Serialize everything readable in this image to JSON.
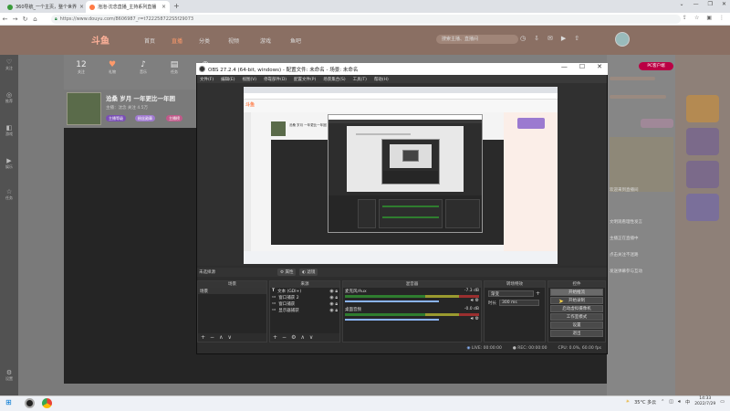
{
  "browser": {
    "tabs": [
      {
        "label": "360导航_一个主页，整个世界",
        "active": false
      },
      {
        "label": "泡泡-沈念直播_主持系列直播",
        "active": true
      }
    ],
    "url": "https://www.douyu.com/8606987_r=t722258722S5f29073",
    "new_tab": "+"
  },
  "site": {
    "logo": "斗鱼",
    "nav": [
      "首页",
      "直播",
      "分类",
      "视频",
      "游戏",
      "鱼吧"
    ],
    "active_nav": "直播",
    "search_placeholder": "搜索主播、直播间",
    "subnav": [
      {
        "n": "12",
        "label": "关注"
      },
      {
        "n": "♥",
        "label": "礼物"
      },
      {
        "n": "♪",
        "label": "音乐"
      },
      {
        "n": "▤",
        "label": "任务"
      },
      {
        "n": "◉",
        "label": "活动"
      }
    ],
    "streamer_title": "沧桑 岁月 一年更比一年困",
    "streamer_sub": "主播：沈念  关注 4.5万",
    "pills": [
      "主播等级",
      "粉丝勋章",
      "主播榜"
    ],
    "sidebar": [
      {
        "icon": "♡",
        "label": "关注"
      },
      {
        "icon": "◎",
        "label": "推荐"
      },
      {
        "icon": "◧",
        "label": "游戏"
      },
      {
        "icon": "▶",
        "label": "娱乐"
      },
      {
        "icon": "☆",
        "label": "任务"
      },
      {
        "icon": "⚙",
        "label": "设置"
      }
    ],
    "pc_download": "PC客户端",
    "right_text": [
      "欢迎来到直播间",
      "文明观看理性发言",
      "主播正在直播中",
      "点击关注不迷路",
      "发送弹幕参与互动"
    ]
  },
  "obs": {
    "title": "OBS 27.2.4 (64-bit, windows) - 配置文件: 未命名 - 场景: 未命名",
    "menu": [
      "文件(F)",
      "编辑(E)",
      "视图(V)",
      "停靠部件(D)",
      "配置文件(P)",
      "场景集合(S)",
      "工具(T)",
      "帮助(H)"
    ],
    "source_bar": "未选择源",
    "source_bar_props": "属性",
    "source_bar_filters": "滤镜",
    "docks": {
      "scenes": {
        "title": "场景",
        "items": [
          "场景"
        ]
      },
      "sources": {
        "title": "来源",
        "items": [
          "文本 (GDI+)",
          "窗口捕获 2",
          "窗口捕获",
          "显示器捕获"
        ]
      },
      "mixer": {
        "title": "混音器",
        "channels": [
          {
            "name": "麦克风/Aux",
            "db": "-7.3 dB"
          },
          {
            "name": "桌面音频",
            "db": "-0.0 dB"
          }
        ]
      },
      "transitions": {
        "title": "转场特效",
        "mode": "渐变",
        "duration_label": "时长",
        "duration": "300 ms"
      },
      "controls": {
        "title": "控件",
        "buttons": [
          "开始推流",
          "开始录制",
          "启动虚拟摄像机",
          "工作室模式",
          "设置",
          "退出"
        ]
      }
    },
    "status": {
      "live": "LIVE: 00:00:00",
      "rec": "REC: 00:00:00",
      "cpu": "CPU: 0.0%, 60.00 fps"
    }
  },
  "taskbar": {
    "weather": "35°C 多云",
    "time": "14:33",
    "date": "2022/7/29"
  },
  "colors": {
    "obs_bg": "#2d2d2d",
    "accent": "#ff7a45",
    "link_blue": "#8ab4f8"
  }
}
